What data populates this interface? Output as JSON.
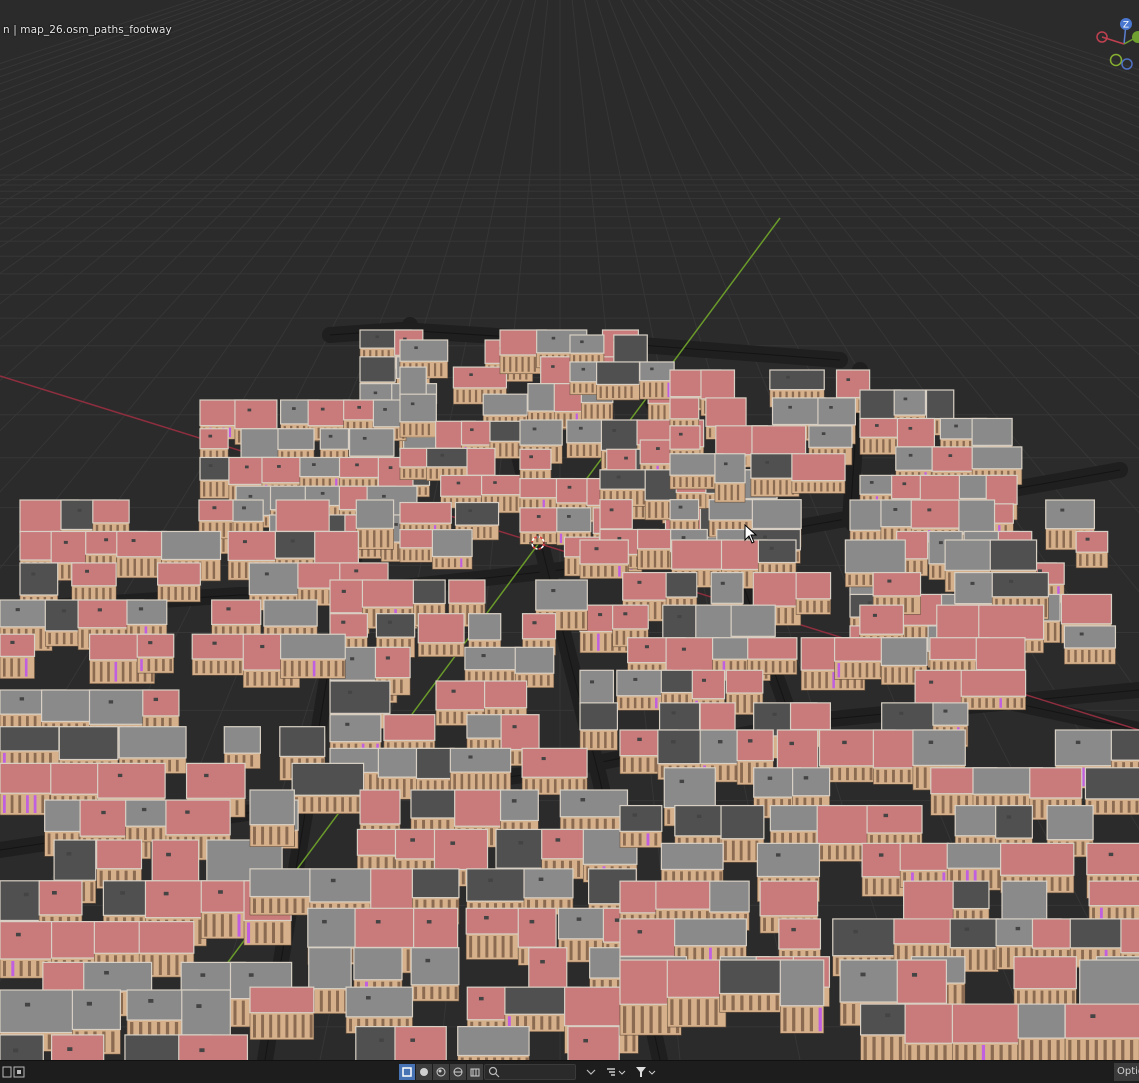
{
  "viewport": {
    "overlay_text": "n | map_26.osm_paths_footway",
    "gizmo_axis_label": "Z"
  },
  "footer": {
    "options_label": "Optio",
    "search_placeholder": ""
  },
  "colors": {
    "background": "#2b2b2b",
    "grid": "#3a3a3a",
    "road": "#1f1f1f",
    "x_axis": "#9a3040",
    "y_axis": "#6b9a2a",
    "roof_pink": "#c97a7a",
    "roof_gray": "#8a8a8a",
    "roof_dark": "#505050",
    "facade": "#d6b08a",
    "accent_blue": "#4772b3"
  },
  "icons": {
    "layout_icon": "viewport-layout-icon",
    "search_icon": "magnifier-icon",
    "filter_icon": "funnel-icon",
    "gizmo": "navigation-gizmo-icon"
  }
}
